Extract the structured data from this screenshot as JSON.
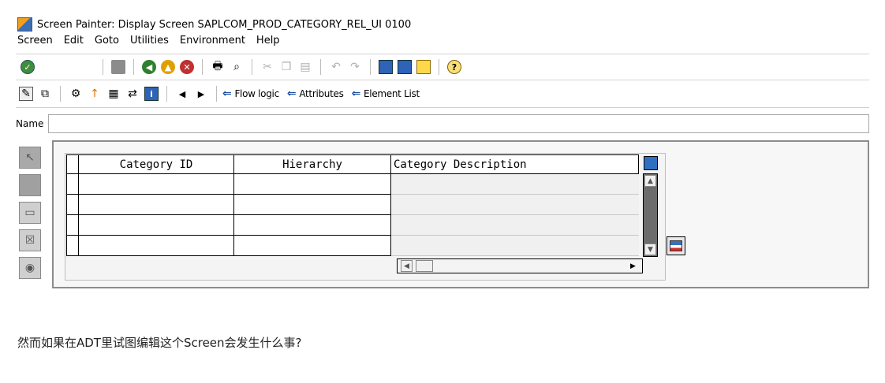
{
  "window": {
    "title": "Screen Painter: Display Screen SAPLCOM_PROD_CATEGORY_REL_UI 0100"
  },
  "menu": [
    "Screen",
    "Edit",
    "Goto",
    "Utilities",
    "Environment",
    "Help"
  ],
  "toolbar2": {
    "flow_logic": "Flow logic",
    "attributes": "Attributes",
    "element_list": "Element List"
  },
  "name_field": {
    "label": "Name",
    "value": ""
  },
  "table": {
    "columns": [
      "Category ID",
      "Hierarchy",
      "Category Description"
    ],
    "row_count": 4
  },
  "caption": "然而如果在ADT里试图编辑这个Screen会发生什么事?"
}
